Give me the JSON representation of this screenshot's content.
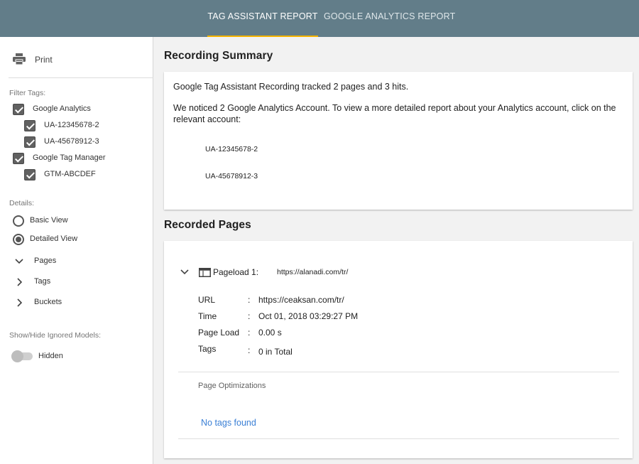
{
  "header": {
    "tabs": [
      {
        "label": "TAG ASSISTANT REPORT",
        "active": true
      },
      {
        "label": "GOOGLE ANALYTICS REPORT",
        "active": false
      }
    ],
    "background": "#627d89",
    "active_indicator_color": "#f5b400"
  },
  "sidebar": {
    "print_label": "Print",
    "print_icon": "printer-icon",
    "filter_label": "Filter Tags:",
    "filters": [
      {
        "label": "Google Analytics",
        "checked": true
      },
      {
        "label": "UA-12345678-2",
        "checked": true
      },
      {
        "label": "UA-45678912-3",
        "checked": true
      },
      {
        "label": "Google Tag Manager",
        "checked": true
      },
      {
        "label": "GTM-ABCDEF",
        "checked": true
      }
    ],
    "details_label": "Details:",
    "views": [
      {
        "label": "Basic View",
        "selected": false
      },
      {
        "label": "Detailed View",
        "selected": true
      }
    ],
    "tree": [
      {
        "label": "Pages",
        "expanded": true
      },
      {
        "label": "Tags",
        "expanded": false
      },
      {
        "label": "Buckets",
        "expanded": false
      }
    ],
    "ignored_label": "Show/Hide Ignored Models:",
    "toggle_label": "Hidden",
    "toggle_on": false
  },
  "main": {
    "summary_title": "Recording Summary",
    "summary_text": "Google Tag Assistant Recording tracked 2 pages and 3 hits.",
    "summary_note": "We noticed 2 Google Analytics Account. To view a more detailed report about your Analytics account, click on the relevant account:",
    "accounts": [
      "UA-12345678-2",
      "UA-45678912-3"
    ],
    "pages_title": "Recorded Pages",
    "pageload": {
      "title": "Pageload 1:",
      "url": "https://alanadi.com/tr/",
      "icon": "browser-window-icon",
      "details": [
        {
          "key": "URL",
          "value": "https://ceaksan.com/tr/"
        },
        {
          "key": "Time",
          "value": "Oct 01, 2018 03:29:27 PM"
        },
        {
          "key": "Page Load",
          "value": "0.00 s"
        },
        {
          "key": "Tags",
          "value": "0 in Total"
        }
      ],
      "optimizations_label": "Page Optimizations",
      "no_tags": "No tags found",
      "link_color": "#3a7fd5"
    }
  }
}
